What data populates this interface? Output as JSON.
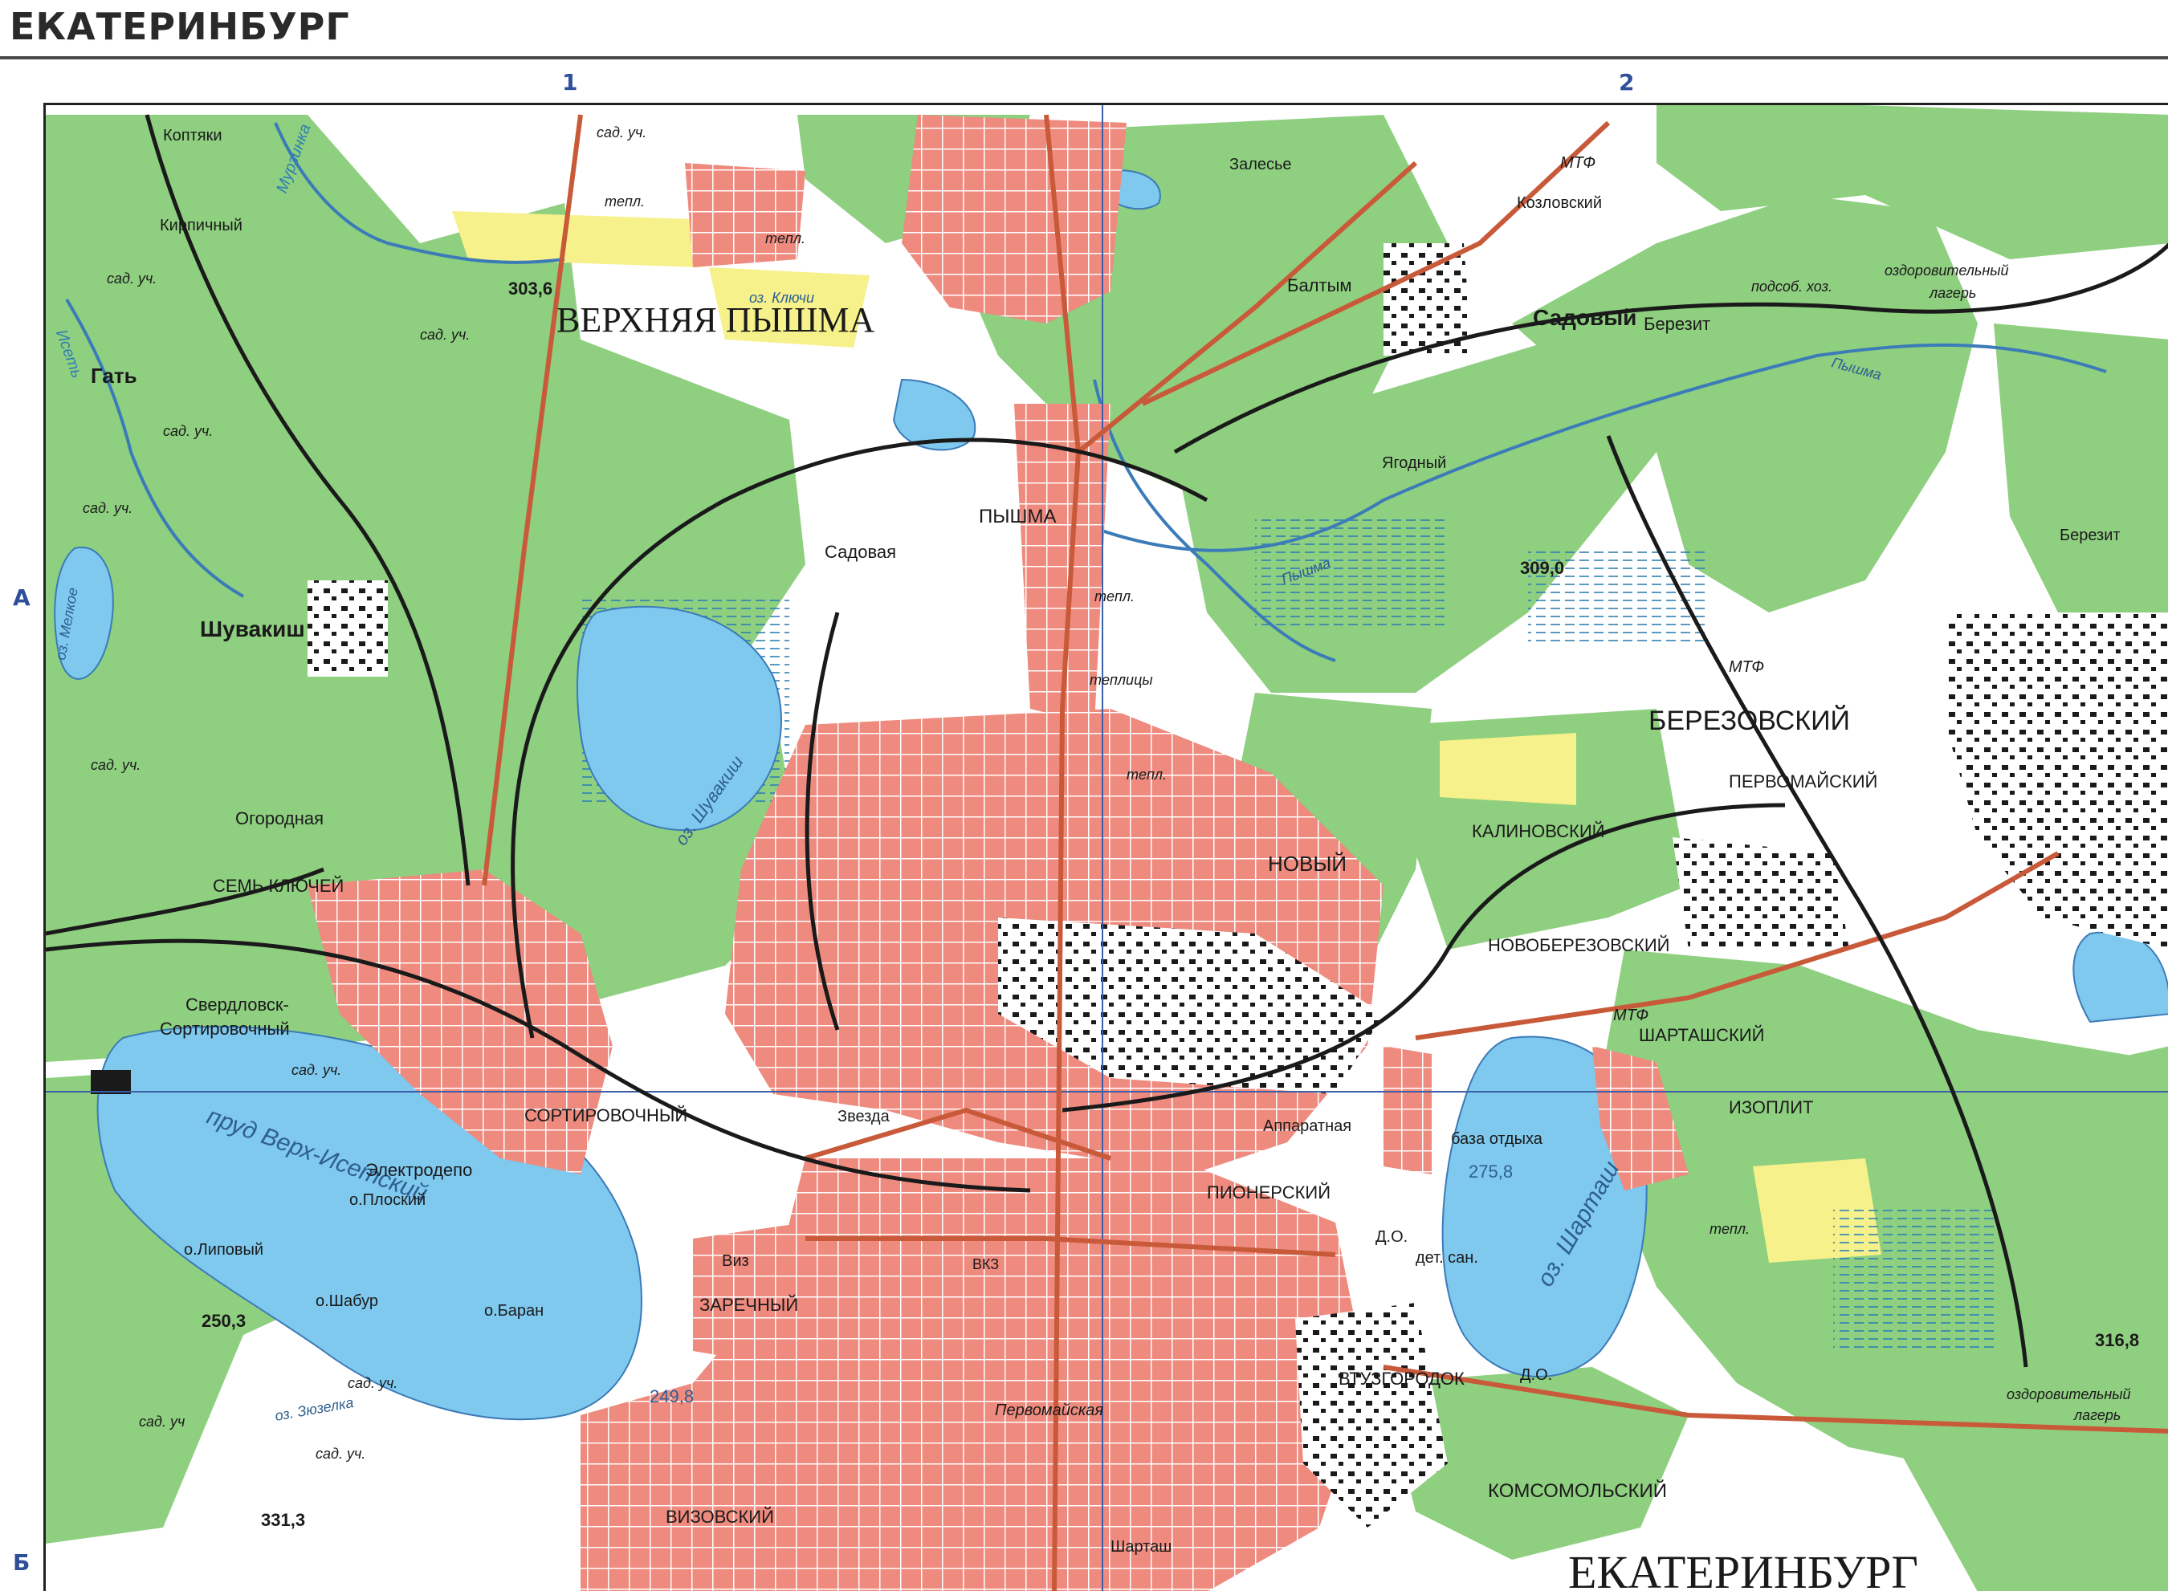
{
  "map": {
    "title": "ЕКАТЕРИНБУРГ",
    "grid_columns": [
      "1",
      "2"
    ],
    "grid_rows": [
      "А",
      "Б"
    ],
    "colors": {
      "forest": "#8fcf80",
      "open_land": "#ffffff",
      "water": "#7fc8ee",
      "urban": "#ee8a7e",
      "road": "#c85a3a",
      "railway": "#1a1a1a",
      "grid": "#3b5fa8",
      "marsh": "#f6f18a"
    },
    "labels": {
      "koptyaki": "Коптяки",
      "kirpichny": "Кирпичный",
      "murzinka": "Мурзинка",
      "sad_uch_1": "сад. уч.",
      "sad_uch_2": "сад. уч.",
      "sad_uch_3": "сад. уч.",
      "sad_uch_4": "сад. уч.",
      "sad_uch_5": "сад. уч.",
      "sad_uch_6": "сад. уч.",
      "sad_uch_7": "сад. уч.",
      "sad_uch_8": "сад. уч",
      "sad_uch_9": "сад. уч.",
      "gat": "Гать",
      "iset": "Исеть",
      "shuvakish": "Шувакиш",
      "oz_melkoe": "оз. Мелкое",
      "ogorodnaya": "Огородная",
      "sem_klyuchey": "СЕМЬ КЛЮЧЕЙ",
      "sverdlovsk_sort": "Свердловск-",
      "sortirovochny_st": "Сортировочный",
      "verkh_isetsky": "пруд Верх-Исетский",
      "elektrodepo": "Электродепо",
      "o_plosky": "о.Плоский",
      "o_lipovy": "о.Липовый",
      "o_shabur": "о.Шабур",
      "o_baran": "о.Баран",
      "h250": "250,3",
      "h249": "249,8",
      "h331": "331,3",
      "zyuzelka": "оз. Зюзелка",
      "h303": "303,6",
      "teppl_1": "тепл.",
      "teppl_2": "тепл.",
      "teppl_3": "тепл.",
      "teppl_4": "тепл.",
      "teppl_5": "тепл.",
      "verkhnyaya_pyshma": "ВЕРХНЯЯ ПЫШМА",
      "klyuchi": "оз. Ключи",
      "pyshma_town": "ПЫШМА",
      "sadovaya": "Садовая",
      "teplitsy": "теплицы",
      "oz_shuvakish": "оз. Шувакиш",
      "zalesye": "Залесье",
      "mtf_1": "МТФ",
      "mtf_2": "МТФ",
      "mtf_3": "МТФ",
      "kozlovsky": "Козловский",
      "baltym": "Балтым",
      "sadovy": "Садовый",
      "berezit_1": "Березит",
      "berezit_2": "Березит",
      "podsob": "подсоб. хоз.",
      "ozdorov_1": "оздоровительный",
      "lager_1": "лагерь",
      "ozdorov_2": "оздоровительный",
      "lager_2": "лагерь",
      "pyshma_river_1": "Пышма",
      "pyshma_river_2": "Пышма",
      "yagodny": "Ягодный",
      "h309": "309,0",
      "berezovsky": "БЕРЕЗОВСКИЙ",
      "pervomaysky_1": "ПЕРВОМАЙСКИЙ",
      "kalinovsky": "КАЛИНОВСКИЙ",
      "novy": "НОВЫЙ",
      "novoberezovsky": "НОВОБЕРЕЗОВСКИЙ",
      "shartashsky": "ШАРТАШСКИЙ",
      "izoplit": "ИЗОПЛИТ",
      "sortirovochny": "СОРТИРОВОЧНЫЙ",
      "zvezda": "Звезда",
      "apparatnaya": "Аппаратная",
      "baza_otdykha": "база отдыха",
      "h275": "275,8",
      "oz_shartash": "оз. Шарташ",
      "pionersky": "ПИОНЕРСКИЙ",
      "do_1": "Д.О.",
      "do_2": "Д.О.",
      "det_san": "дет. сан.",
      "viz": "Виз",
      "vkz": "ВКЗ",
      "zarechny": "ЗАРЕЧНЫЙ",
      "vtuzgorodok": "ВТУЗГОРОДОК",
      "pervomayskaya": "Первомайская",
      "komsomolsky": "КОМСОМОЛЬСКИЙ",
      "vizovsky": "ВИЗОВСКИЙ",
      "shartash_st": "Шарташ",
      "ekaterinburg_big": "ЕКАТЕРИНБУРГ",
      "h316": "316,8"
    }
  }
}
